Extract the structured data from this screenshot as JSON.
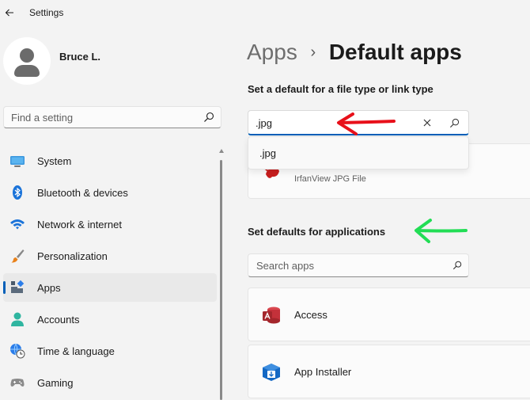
{
  "window": {
    "title": "Settings"
  },
  "user": {
    "name": "Bruce L."
  },
  "search": {
    "placeholder": "Find a setting"
  },
  "nav": {
    "items": [
      {
        "label": "System",
        "icon": "monitor-icon"
      },
      {
        "label": "Bluetooth & devices",
        "icon": "bluetooth-icon"
      },
      {
        "label": "Network & internet",
        "icon": "wifi-icon"
      },
      {
        "label": "Personalization",
        "icon": "paintbrush-icon"
      },
      {
        "label": "Apps",
        "icon": "apps-icon",
        "active": true
      },
      {
        "label": "Accounts",
        "icon": "person-icon"
      },
      {
        "label": "Time & language",
        "icon": "globe-clock-icon"
      },
      {
        "label": "Gaming",
        "icon": "gamepad-icon"
      }
    ]
  },
  "breadcrumb": {
    "parent": "Apps",
    "separator": "›",
    "current": "Default apps"
  },
  "filetype": {
    "heading": "Set a default for a file type or link type",
    "value": ".jpg",
    "suggestion": ".jpg",
    "result": {
      "description": "IrfanView JPG File",
      "icon": "irfanview-icon"
    }
  },
  "apps_section": {
    "heading": "Set defaults for applications",
    "search_placeholder": "Search apps",
    "items": [
      {
        "name": "Access",
        "icon": "access-icon"
      },
      {
        "name": "App Installer",
        "icon": "app-installer-icon"
      }
    ]
  },
  "annotations": {
    "red_arrow_color": "#e8101a",
    "green_arrow_color": "#22dd55"
  },
  "colors": {
    "accent": "#005fb8",
    "background": "#f3f3f3"
  }
}
